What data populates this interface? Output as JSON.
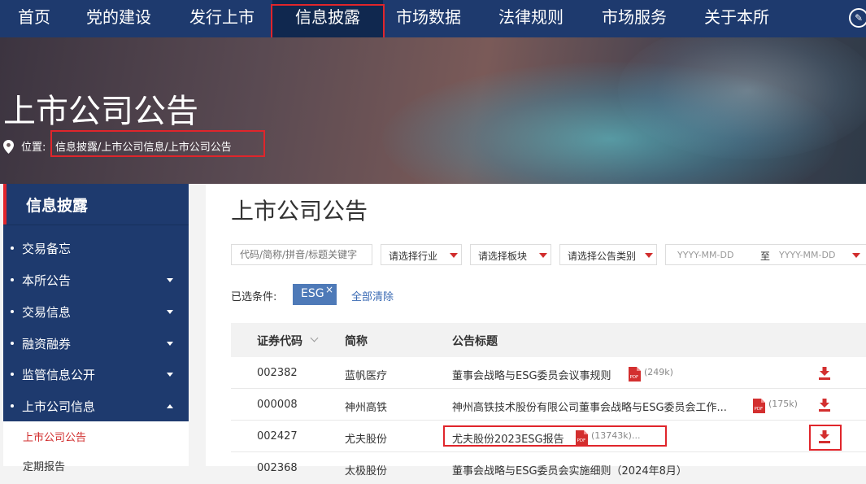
{
  "nav": {
    "items": [
      "首页",
      "党的建设",
      "发行上市",
      "信息披露",
      "市场数据",
      "法律规则",
      "市场服务",
      "关于本所"
    ],
    "active": "信息披露"
  },
  "banner": {
    "title": "上市公司公告",
    "location_label": "位置:",
    "breadcrumb": "信息披露/上市公司信息/上市公司公告"
  },
  "sidebar": {
    "title": "信息披露",
    "items": [
      {
        "label": "交易备忘"
      },
      {
        "label": "本所公告"
      },
      {
        "label": "交易信息"
      },
      {
        "label": "融资融券"
      },
      {
        "label": "监管信息公开"
      },
      {
        "label": "上市公司信息"
      }
    ],
    "sub_items": [
      {
        "label": "上市公司公告"
      },
      {
        "label": "定期报告"
      }
    ]
  },
  "main": {
    "title": "上市公司公告",
    "filters": {
      "search_placeholder": "代码/简称/拼音/标题关键字",
      "industry": "请选择行业",
      "board": "请选择板块",
      "category": "请选择公告类别",
      "date_from": "YYYY-MM-DD",
      "date_sep": "至",
      "date_to": "YYYY-MM-DD"
    },
    "conditions_label": "已选条件:",
    "chip": "ESG",
    "chip_close": "×",
    "clear_all": "全部清除",
    "table": {
      "headers": [
        "证券代码",
        "简称",
        "公告标题"
      ],
      "rows": [
        {
          "code": "002382",
          "name": "蓝帆医疗",
          "title": "董事会战略与ESG委员会议事规则",
          "size": "(249k)"
        },
        {
          "code": "000008",
          "name": "神州高铁",
          "title": "神州高铁技术股份有限公司董事会战略与ESG委员会工作...",
          "size": "(175k)"
        },
        {
          "code": "002427",
          "name": "尤夫股份",
          "title": "尤夫股份2023ESG报告",
          "size": "(13743k)..."
        },
        {
          "code": "002368",
          "name": "太极股份",
          "title": "董事会战略与ESG委员会实施细则（2024年8月）",
          "size": ""
        }
      ]
    }
  },
  "colors": {
    "nav_bg": "#1e3a6e",
    "accent_red": "#e0252b",
    "link_blue": "#3a6ab3",
    "chip_bg": "#4e7ab8"
  }
}
